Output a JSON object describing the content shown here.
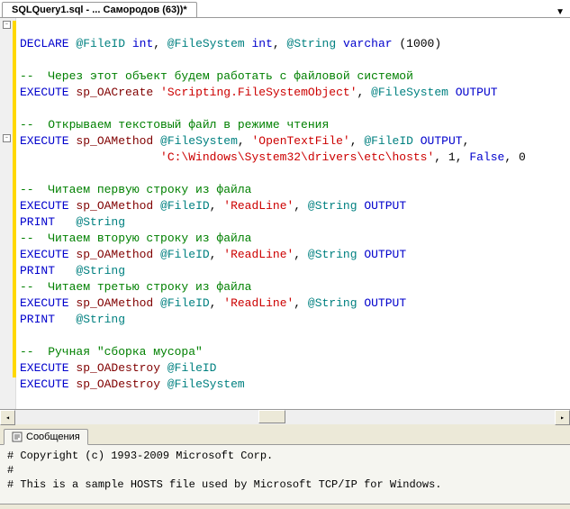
{
  "tab": {
    "title": "SQLQuery1.sql - ... Самородов (63))*"
  },
  "code": {
    "declare": "DECLARE",
    "fileid": "@FileID",
    "int": "int",
    "filesystem": "@FileSystem",
    "string": "@String",
    "varchar": "varchar",
    "thousand": "1000",
    "execute": "EXECUTE",
    "print": "PRINT",
    "output": "OUTPUT",
    "false": "False",
    "one": "1",
    "zero": "0",
    "sp_create": "sp_OACreate",
    "sp_method": "sp_OAMethod",
    "sp_destroy": "sp_OADestroy",
    "str_fso": "'Scripting.FileSystemObject'",
    "str_open": "'OpenTextFile'",
    "str_path": "'C:\\Windows\\System32\\drivers\\etc\\hosts'",
    "str_read": "'ReadLine'",
    "cmt1": "--  Через этот объект будем работать с файловой системой",
    "cmt2": "--  Открываем текстовый файл в режиме чтения",
    "cmt3": "--  Читаем первую строку из файла",
    "cmt4": "--  Читаем вторую строку из файла",
    "cmt5": "--  Читаем третью строку из файла",
    "cmt6": "--  Ручная \"сборка мусора\""
  },
  "messages": {
    "tab_label": "Сообщения",
    "line1": "# Copyright (c) 1993-2009 Microsoft Corp.",
    "line2": "#",
    "line3": "# This is a sample HOSTS file used by Microsoft TCP/IP for Windows."
  }
}
